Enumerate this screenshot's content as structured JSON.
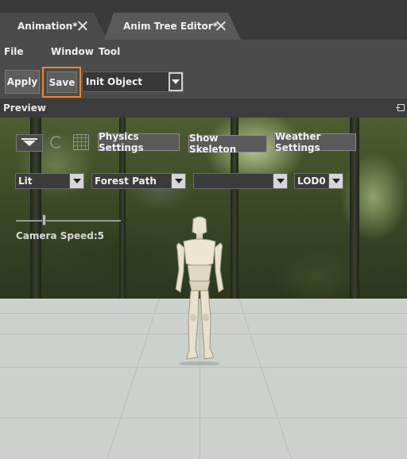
{
  "tabs": [
    {
      "label": "Animation*",
      "active": false
    },
    {
      "label": "Anim Tree Editor*",
      "active": true
    }
  ],
  "menu": {
    "file": "File",
    "window": "Window",
    "tool": "Tool"
  },
  "toolbar": {
    "apply_label": "Apply",
    "save_label": "Save",
    "object_select_value": "Init Object"
  },
  "preview": {
    "title": "Preview",
    "physics_settings_label": "Physics Settings",
    "show_skeleton_label": "Show Skeleton",
    "weather_settings_label": "Weather Settings",
    "render_mode_value": "Lit",
    "environment_value": "Forest Path",
    "animation_value": "",
    "lod_value": "LOD0",
    "camera_speed_label": "Camera Speed:5",
    "camera_speed_value": 5
  },
  "colors": {
    "save_highlight": "#e8892e",
    "ground": "#cdd1cd",
    "toolbar_bg": "#4b4b4b"
  },
  "icons": [
    "close-icon",
    "lighting-icon",
    "refresh-icon",
    "grid-icon",
    "pin-icon",
    "dropdown-arrow-icon"
  ]
}
